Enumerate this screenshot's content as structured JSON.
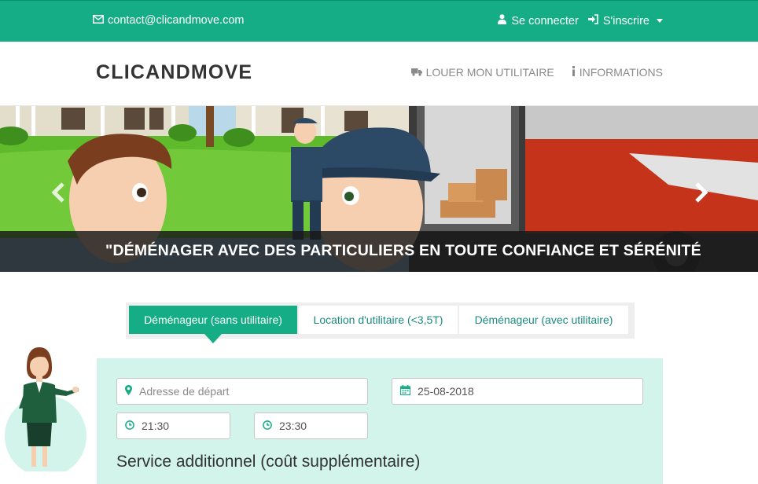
{
  "topbar": {
    "email": "contact@clicandmove.com",
    "login": "Se connecter",
    "signup": "S'inscrire"
  },
  "nav": {
    "brand": "CLICANDMOVE",
    "links": [
      {
        "label": "LOUER MON UTILITAIRE",
        "icon": "truck-icon"
      },
      {
        "label": "INFORMATIONS",
        "icon": "info-icon"
      }
    ]
  },
  "hero": {
    "caption": "\"DÉMÉNAGER AVEC DES PARTICULIERS EN TOUTE CONFIANCE ET SÉRÉNITÉ"
  },
  "tabs": [
    {
      "label": "Déménageur (sans utilitaire)",
      "active": true
    },
    {
      "label": "Location d'utilitaire (<3,5T)",
      "active": false
    },
    {
      "label": "Déménageur (avec utilitaire)",
      "active": false
    }
  ],
  "form": {
    "address_placeholder": "Adresse de départ",
    "date_value": "25-08-2018",
    "time_start": "21:30",
    "time_end": "23:30",
    "service_title": "Service additionnel (coût supplémentaire)"
  },
  "colors": {
    "brand_green": "#14ad85",
    "panel_bg": "#d2f4ea",
    "tab_text": "#1b8a80"
  }
}
